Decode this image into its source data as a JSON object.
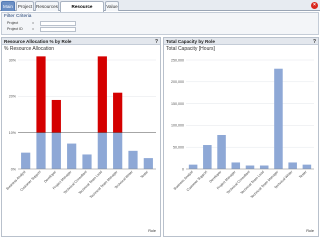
{
  "tabs": [
    {
      "label": "Main"
    },
    {
      "label": "Project"
    },
    {
      "label": "Resources"
    },
    {
      "label": "Resource Allocation"
    },
    {
      "label": "Value"
    }
  ],
  "active_tab": "Resource Allocation",
  "filter": {
    "title": "Filter Criteria",
    "rows": [
      {
        "label": "Project",
        "operator": "="
      },
      {
        "label": "Project ID",
        "operator": "="
      }
    ]
  },
  "left_panel": {
    "header": "Resource Allocation % by Role",
    "help_label": "?"
  },
  "right_panel": {
    "header": "Total Capacity by Role",
    "help_label": "?"
  },
  "colors": {
    "accent": "#557bb5",
    "base_bar": "#8ea8d6",
    "over_bar": "#d40000",
    "close_button": "#d9261c"
  },
  "chart_data": [
    {
      "type": "bar",
      "title": "% Resource Allocation",
      "xlabel": "Role",
      "ylabel": "",
      "ylim": [
        0,
        30
      ],
      "yticks": [
        "0%",
        "10%",
        "20%",
        "30%"
      ],
      "categories": [
        "Business Analyst",
        "Customer Support",
        "Developer",
        "Project Manager",
        "Technical Consultant",
        "Technical Team Lead",
        "Technical Team Manager",
        "Technical Writer",
        "Tester"
      ],
      "threshold": 10,
      "series": [
        {
          "values": [
            4.5,
            10,
            10,
            7,
            4,
            10,
            10,
            5,
            3
          ]
        },
        {
          "values": [
            0,
            21,
            9,
            0,
            0,
            21,
            11,
            0,
            0
          ]
        }
      ]
    },
    {
      "type": "bar",
      "title": "Total Capacity [Hours]",
      "xlabel": "Role",
      "ylabel": "",
      "ylim": [
        0,
        250000
      ],
      "yticks": [
        "0",
        "50,000",
        "100,000",
        "150,000",
        "200,000",
        "250,000"
      ],
      "categories": [
        "Business Analyst",
        "Customer Support",
        "Developer",
        "Project Manager",
        "Technical Consultant",
        "Technical Team Lead",
        "Technical Team Manager",
        "Technical Writer",
        "Tester"
      ],
      "series": [
        {
          "values": [
            10000,
            55000,
            78000,
            15000,
            8000,
            8000,
            230000,
            15000,
            10000
          ]
        }
      ]
    }
  ]
}
